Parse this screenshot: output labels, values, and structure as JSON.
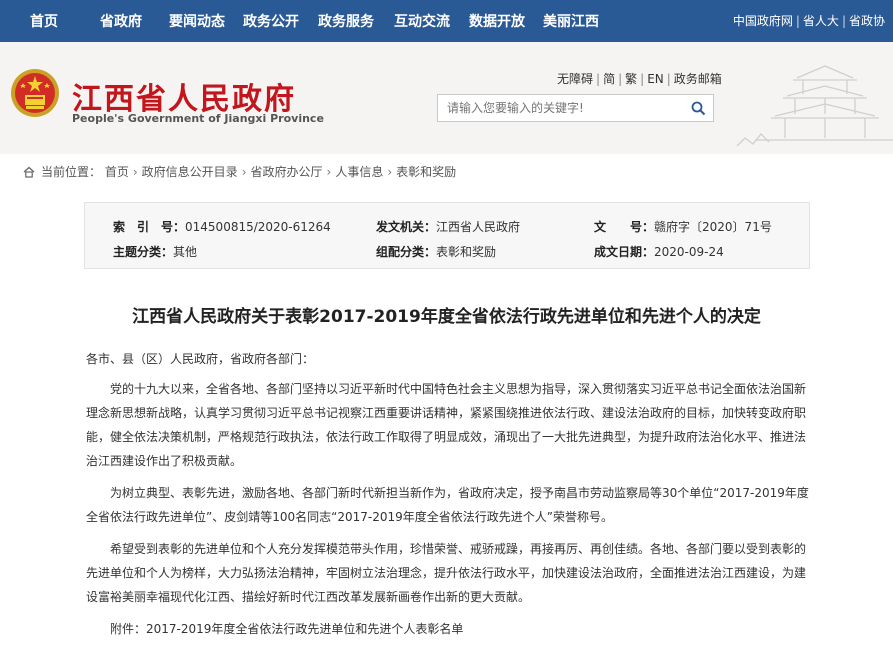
{
  "topnav": {
    "items": [
      "首页",
      "省政府",
      "要闻动态",
      "政务公开",
      "政务服务",
      "互动交流",
      "数据开放",
      "美丽江西"
    ],
    "right_links": [
      "中国政府网",
      "省人大",
      "省政协"
    ]
  },
  "header": {
    "title": "江西省人民政府",
    "subtitle": "People's Government of Jiangxi Province",
    "util_links": [
      "无障碍",
      "简",
      "繁",
      "EN",
      "政务邮箱"
    ],
    "search_placeholder": "请输入您要输入的关键字!"
  },
  "breadcrumb": {
    "label": "当前位置：",
    "items": [
      "首页",
      "政府信息公开目录",
      "省政府办公厅",
      "人事信息",
      "表彰和奖励"
    ]
  },
  "info": {
    "index_key": "索　引　号：",
    "index_val": "014500815/2020-61264",
    "issuer_key": "发文机关：",
    "issuer_val": "江西省人民政府",
    "docno_key": "文　　号：",
    "docno_val": "赣府字〔2020〕71号",
    "topic_key": "主题分类：",
    "topic_val": "其他",
    "category_key": "组配分类：",
    "category_val": "表彰和奖励",
    "date_key": "成文日期：",
    "date_val": "2020-09-24"
  },
  "document": {
    "title": "江西省人民政府关于表彰2017-2019年度全省依法行政先进单位和先进个人的决定",
    "salutation": "各市、县（区）人民政府，省政府各部门：",
    "paragraphs": [
      "党的十九大以来，全省各地、各部门坚持以习近平新时代中国特色社会主义思想为指导，深入贯彻落实习近平总书记全面依法治国新理念新思想新战略，认真学习贯彻习近平总书记视察江西重要讲话精神，紧紧围绕推进依法行政、建设法治政府的目标，加快转变政府职能，健全依法决策机制，严格规范行政执法，依法行政工作取得了明显成效，涌现出了一大批先进典型，为提升政府法治化水平、推进法治江西建设作出了积极贡献。",
      "为树立典型、表彰先进，激励各地、各部门新时代新担当新作为，省政府决定，授予南昌市劳动监察局等30个单位“2017-2019年度全省依法行政先进单位”、皮剑靖等100名同志“2017-2019年度全省依法行政先进个人”荣誉称号。",
      "希望受到表彰的先进单位和个人充分发挥模范带头作用，珍惜荣誉、戒骄戒躁，再接再厉、再创佳绩。各地、各部门要以受到表彰的先进单位和个人为榜样，大力弘扬法治精神，牢固树立法治理念，提升依法行政水平，加快建设法治政府，全面推进法治江西建设，为建设富裕美丽幸福现代化江西、描绘好新时代江西改革发展新画卷作出新的更大贡献。"
    ],
    "attachment": "附件：2017-2019年度全省依法行政先进单位和先进个人表彰名单"
  }
}
